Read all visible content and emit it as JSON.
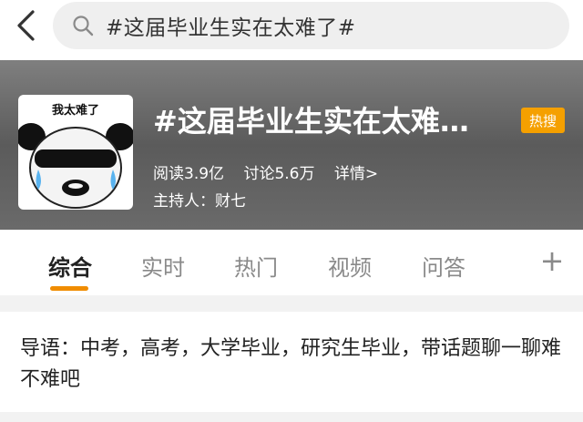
{
  "search": {
    "query": "#这届毕业生实在太难了#"
  },
  "topic": {
    "avatar_caption": "我太难了",
    "title": "#这届毕业生实在太难…",
    "badge": "热搜",
    "reads": "阅读3.9亿",
    "discussions": "讨论5.6万",
    "details": "详情>",
    "host": "主持人：财七"
  },
  "tabs": [
    {
      "label": "综合",
      "active": true
    },
    {
      "label": "实时"
    },
    {
      "label": "热门"
    },
    {
      "label": "视频"
    },
    {
      "label": "问答"
    }
  ],
  "add_tab": "+",
  "intro": {
    "text": "导语：中考，高考，大学毕业，研究生毕业，带话题聊一聊难不难吧"
  },
  "colors": {
    "accent": "#f08c00",
    "badge": "#f5a000",
    "header_bg": "#6a6a6a"
  }
}
